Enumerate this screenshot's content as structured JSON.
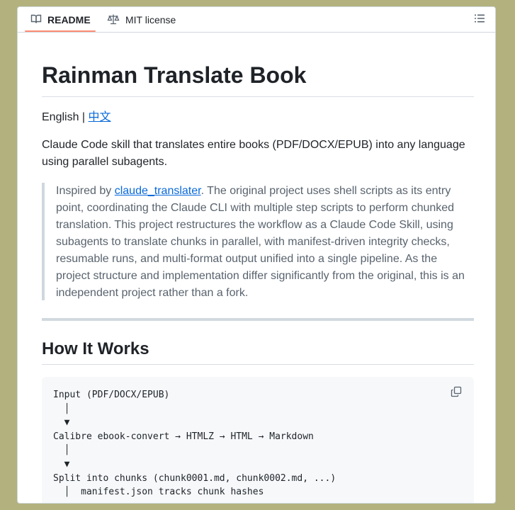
{
  "tabs": [
    {
      "label": "README",
      "icon": "book-icon",
      "active": true
    },
    {
      "label": "MIT license",
      "icon": "scale-icon",
      "active": false
    }
  ],
  "readme": {
    "title": "Rainman Translate Book",
    "lang_english": "English",
    "lang_separator": " | ",
    "lang_chinese": "中文",
    "description": "Claude Code skill that translates entire books (PDF/DOCX/EPUB) into any language using parallel subagents.",
    "quote_prefix": "Inspired by ",
    "quote_link": "claude_translater",
    "quote_text": ". The original project uses shell scripts as its entry point, coordinating the Claude CLI with multiple step scripts to perform chunked translation. This project restructures the workflow as a Claude Code Skill, using subagents to translate chunks in parallel, with manifest-driven integrity checks, resumable runs, and multi-format output unified into a single pipeline. As the project structure and implementation differ significantly from the original, this is an independent project rather than a fork.",
    "section_title": "How It Works",
    "code": "Input (PDF/DOCX/EPUB)\n  │\n  ▼\nCalibre ebook-convert → HTMLZ → HTML → Markdown\n  │\n  ▼\nSplit into chunks (chunk0001.md, chunk0002.md, ...)\n  │  manifest.json tracks chunk hashes\n  ▼"
  },
  "colors": {
    "link": "#0969da",
    "active_tab_underline": "#fd8c73",
    "background": "#b3b27e"
  }
}
